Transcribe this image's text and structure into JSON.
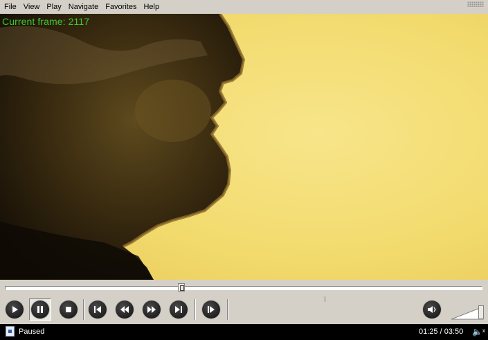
{
  "menu": {
    "items": [
      "File",
      "View",
      "Play",
      "Navigate",
      "Favorites",
      "Help"
    ]
  },
  "video": {
    "overlay_text": "Current frame: 2117"
  },
  "seek": {
    "progress_fraction": 0.371
  },
  "controls": {
    "buttons": [
      {
        "name": "play-icon"
      },
      {
        "name": "pause-icon",
        "pressed": true
      },
      {
        "name": "stop-icon"
      },
      {
        "name": "previous-icon"
      },
      {
        "name": "rewind-icon"
      },
      {
        "name": "fast-forward-icon"
      },
      {
        "name": "next-icon"
      },
      {
        "name": "frame-step-icon"
      },
      {
        "name": "volume-icon"
      }
    ],
    "volume_level": 1.0
  },
  "status": {
    "state": "Paused",
    "time": "01:25 / 03:50",
    "icon": "document-icon"
  },
  "colors": {
    "overlay_text": "#3ecb2e",
    "background_yellow": "#f2dc72",
    "chrome": "#d4d0c8"
  }
}
